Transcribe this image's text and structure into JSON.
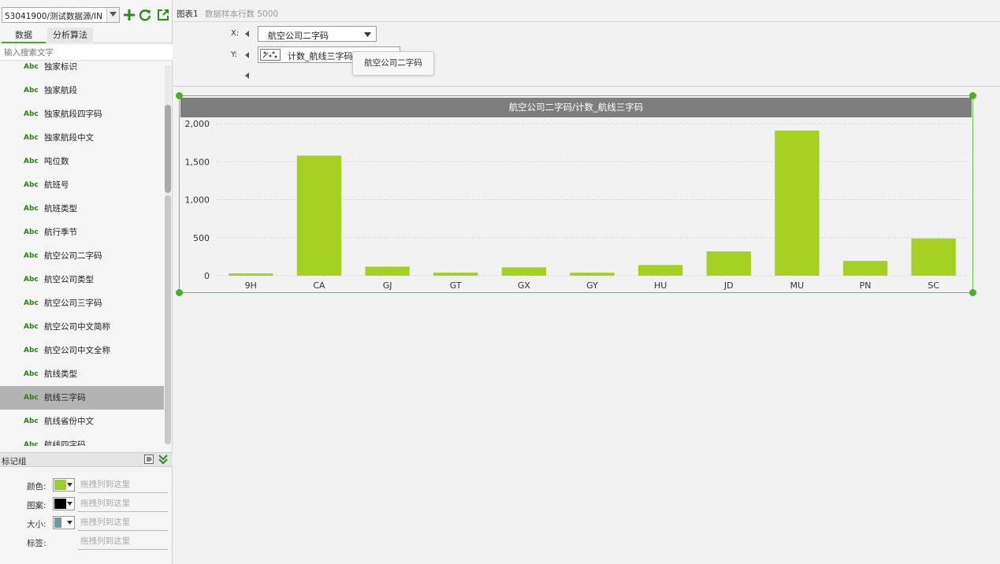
{
  "left_panel": {
    "datasource": "53041900/测试数据源/IN",
    "tabs": [
      "数据",
      "分析算法"
    ],
    "search_placeholder": "输入搜索文字",
    "field_type_label": "Abc",
    "fields": [
      "独家标识",
      "独家航段",
      "独家航段四字码",
      "独家航段中文",
      "吨位数",
      "航班号",
      "航班类型",
      "航行季节",
      "航空公司二字码",
      "航空公司类型",
      "航空公司三字码",
      "航空公司中文简称",
      "航空公司中文全称",
      "航线类型",
      "航线三字码",
      "航线省份中文",
      "航线四字码"
    ],
    "selected_field": "航线三字码",
    "mark_group": {
      "title": "标记组",
      "rows": [
        {
          "label": "颜色:",
          "swatch": "#9ecf2a",
          "drop": "拖拽列到这里"
        },
        {
          "label": "图案:",
          "swatch": "#000000",
          "drop": "拖拽列到这里"
        },
        {
          "label": "大小:",
          "swatch": "#6b9aa3",
          "drop": "拖拽列到这里"
        },
        {
          "label": "标签:",
          "swatch": "",
          "drop": "拖拽列到这里"
        }
      ]
    }
  },
  "main": {
    "chart_name": "图表1",
    "sample_rows": "数据样本行数 5000",
    "x_label": "X:",
    "y_label": "Y:",
    "x_value": "航空公司二字码",
    "y_value": "计数_航线三字码",
    "tooltip": "航空公司二字码"
  },
  "colors": {
    "bar": "#a3d023",
    "accent": "#5aa02c",
    "title_bar": "#7d7d7d"
  },
  "chart_data": {
    "type": "bar",
    "title": "航空公司二字码/计数_航线三字码",
    "categories": [
      "9H",
      "CA",
      "GJ",
      "GT",
      "GX",
      "GY",
      "HU",
      "JD",
      "MU",
      "PN",
      "SC"
    ],
    "values": [
      30,
      1580,
      120,
      40,
      110,
      40,
      140,
      320,
      1910,
      195,
      490
    ],
    "ylim": [
      0,
      2000
    ],
    "yticks": [
      0,
      500,
      1000,
      1500,
      2000
    ],
    "ytick_labels": [
      "0",
      "500",
      "1,000",
      "1,500",
      "2,000"
    ],
    "grid": true
  }
}
